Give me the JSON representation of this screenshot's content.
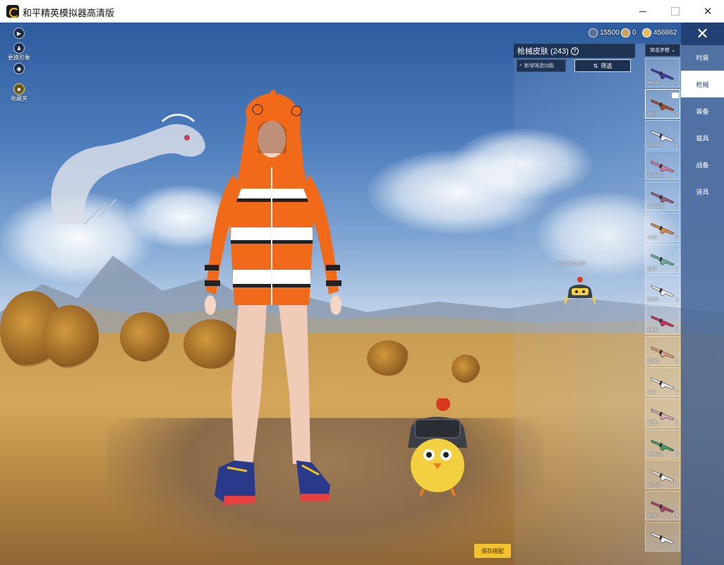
{
  "window": {
    "title": "和平精英模拟器高清版"
  },
  "toolbar": {
    "items": [
      {
        "name": "play",
        "label": "",
        "glyph": "▶"
      },
      {
        "name": "change-appearance",
        "label": "更换形象",
        "glyph": "♟"
      },
      {
        "name": "view",
        "label": "",
        "glyph": "◉"
      },
      {
        "name": "collect",
        "label": "收藏夹",
        "glyph": "☻"
      }
    ]
  },
  "currency": [
    {
      "name": "silver",
      "value": "15500",
      "color": "#5b6f8f"
    },
    {
      "name": "bronze",
      "value": "0",
      "color": "#c9a060"
    },
    {
      "name": "gold",
      "value": "456862",
      "color": "#e3c15a"
    }
  ],
  "skin_panel": {
    "title": "枪械皮肤 (243)",
    "help_glyph": "?",
    "search_placeholder": "新增筛选功能",
    "filter_label": "筛选",
    "hint": "请在右侧选择皮肤",
    "category": "突击步枪"
  },
  "weapons": [
    {
      "name": "M416",
      "count": "4",
      "color": "#3a3aa8",
      "selected": false,
      "equipped": false
    },
    {
      "name": "AKM",
      "count": "8",
      "color": "#b04a20",
      "selected": true,
      "equipped": true
    },
    {
      "name": "M16A4",
      "count": "4",
      "color": "#e8eef5",
      "selected": false,
      "equipped": false
    },
    {
      "name": "SCAR-L",
      "count": "7",
      "color": "#e07aa0",
      "selected": false,
      "equipped": false
    },
    {
      "name": "GROZA",
      "count": "7",
      "color": "#a05a80",
      "selected": false,
      "equipped": false
    },
    {
      "name": "AUG",
      "count": "8",
      "color": "#e08a40",
      "selected": false,
      "equipped": false
    },
    {
      "name": "QBZ",
      "count": "2",
      "color": "#6ab0a0",
      "selected": false,
      "equipped": false
    },
    {
      "name": "M762",
      "count": "4",
      "color": "#f0f0f0",
      "selected": false,
      "equipped": false
    },
    {
      "name": "Mk47",
      "count": "4",
      "color": "#d03060",
      "selected": false,
      "equipped": false
    },
    {
      "name": "G36C",
      "count": "2",
      "color": "#e0a080",
      "selected": false,
      "equipped": false
    },
    {
      "name": "VAL",
      "count": "4",
      "color": "#f5f5f5",
      "selected": false,
      "equipped": false
    },
    {
      "name": "蜜獾",
      "count": "6",
      "color": "#e0b0c0",
      "selected": false,
      "equipped": false
    },
    {
      "name": "FAMAS",
      "count": "3",
      "color": "#40a060",
      "selected": false,
      "equipped": false
    },
    {
      "name": "ACE32",
      "count": "1",
      "color": "#f0f0f0",
      "selected": false,
      "equipped": false
    },
    {
      "name": "ARX",
      "count": "4",
      "color": "#b04070",
      "selected": false,
      "equipped": false
    },
    {
      "name": "",
      "count": "",
      "color": "#f5f5f5",
      "selected": false,
      "equipped": false
    }
  ],
  "nav": {
    "close_glyph": "✕",
    "tabs": [
      {
        "label": "时装",
        "active": false
      },
      {
        "label": "枪械",
        "active": true
      },
      {
        "label": "装备",
        "active": false
      },
      {
        "label": "载具",
        "active": false
      },
      {
        "label": "战备",
        "active": false
      },
      {
        "label": "道具",
        "active": false
      }
    ]
  },
  "save_label": "保存搭配"
}
